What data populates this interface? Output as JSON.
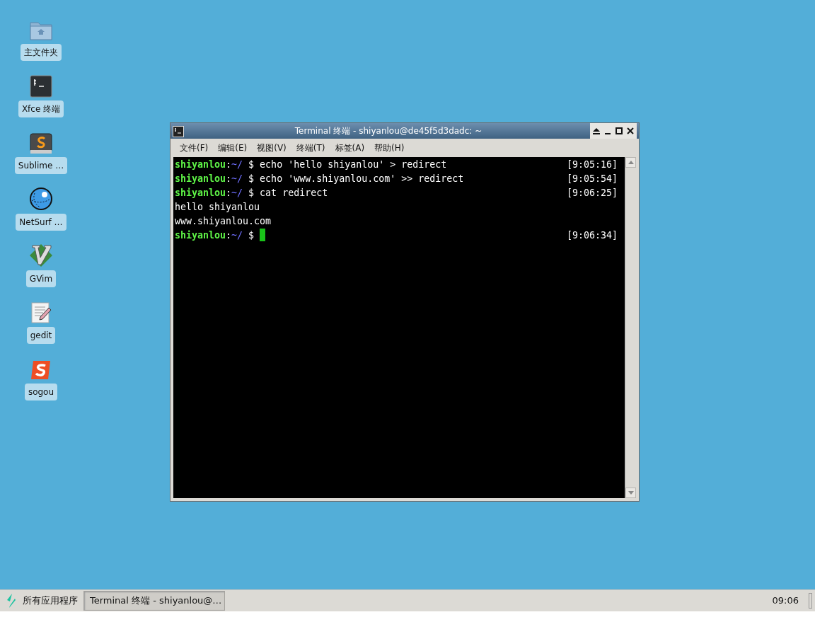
{
  "desktop_icons": [
    {
      "label": "主文件夹"
    },
    {
      "label": "Xfce 终端"
    },
    {
      "label": "Sublime …"
    },
    {
      "label": "NetSurf …"
    },
    {
      "label": "GVim"
    },
    {
      "label": "gedit"
    },
    {
      "label": "sogou"
    }
  ],
  "window": {
    "title": "Terminal 终端 - shiyanlou@de45f5d3dadc: ~",
    "menu": [
      "文件(F)",
      "编辑(E)",
      "视图(V)",
      "终端(T)",
      "标签(A)",
      "帮助(H)"
    ],
    "lines": [
      {
        "kind": "prompt",
        "user": "shiyanlou",
        "separator": ":",
        "path": "~/",
        "symbol": "$",
        "command": "echo 'hello shiyanlou' > redirect",
        "time": "[9:05:16]",
        "cursor": false
      },
      {
        "kind": "prompt",
        "user": "shiyanlou",
        "separator": ":",
        "path": "~/",
        "symbol": "$",
        "command": "echo 'www.shiyanlou.com' >> redirect",
        "time": "[9:05:54]",
        "cursor": false
      },
      {
        "kind": "prompt",
        "user": "shiyanlou",
        "separator": ":",
        "path": "~/",
        "symbol": "$",
        "command": "cat redirect",
        "time": "[9:06:25]",
        "cursor": false
      },
      {
        "kind": "output",
        "text": "hello shiyanlou"
      },
      {
        "kind": "output",
        "text": "www.shiyanlou.com"
      },
      {
        "kind": "prompt",
        "user": "shiyanlou",
        "separator": ":",
        "path": "~/",
        "symbol": "$",
        "time": "[9:06:34]",
        "cursor": true
      }
    ]
  },
  "taskbar": {
    "menu_label": "所有应用程序",
    "tasks": [
      {
        "label": "Terminal 终端 - shiyanlou@…",
        "selected": true
      }
    ],
    "clock": "09:06"
  }
}
